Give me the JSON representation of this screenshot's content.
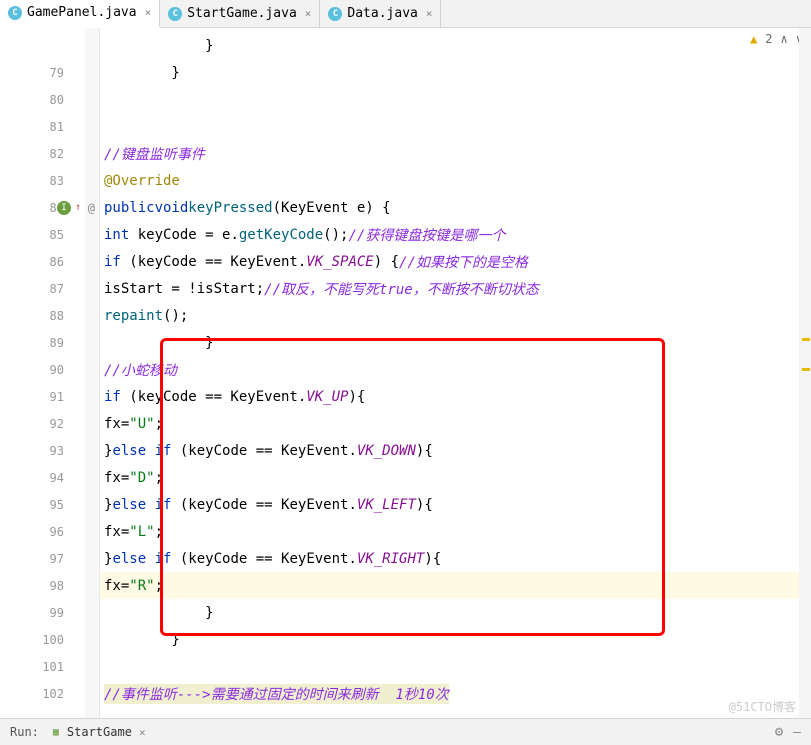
{
  "tabs": [
    {
      "label": "GamePanel.java",
      "active": true
    },
    {
      "label": "StartGame.java",
      "active": false
    },
    {
      "label": "Data.java",
      "active": false
    }
  ],
  "warnings": {
    "count": "2"
  },
  "gutter": {
    "lines": [
      "",
      "79",
      "80",
      "81",
      "82",
      "83",
      "84",
      "85",
      "86",
      "87",
      "88",
      "89",
      "90",
      "91",
      "92",
      "93",
      "94",
      "95",
      "96",
      "97",
      "98",
      "99",
      "100",
      "101",
      "102"
    ]
  },
  "code": {
    "l79": "        }",
    "l82_comment": "//键盘监听事件",
    "l83_anno": "@Override",
    "l84_kw1": "public",
    "l84_kw2": "void",
    "l84_method": "keyPressed",
    "l84_rest": "(KeyEvent e) {",
    "l85_kw": "int",
    "l85_rest": " keyCode = e.",
    "l85_call": "getKeyCode",
    "l85_paren": "();",
    "l85_comment": "//获得键盘按键是哪一个",
    "l86_kw": "if",
    "l86_rest": " (keyCode == KeyEvent.",
    "l86_const": "VK_SPACE",
    "l86_paren": ") {",
    "l86_comment": "//如果按下的是空格",
    "l87_text": "isStart = !isStart;",
    "l87_comment": "//取反，不能写死true，不断按不断切状态",
    "l88_call": "repaint",
    "l88_paren": "();",
    "l89": "            }",
    "l90_comment": "//小蛇移动",
    "l91_kw": "if",
    "l91_rest": " (keyCode == KeyEvent.",
    "l91_const": "VK_UP",
    "l91_paren": "){",
    "l92_a": "fx=",
    "l92_str": "\"U\"",
    "l92_b": ";",
    "l93_a": "}",
    "l93_kw": "else if",
    "l93_rest": " (keyCode == KeyEvent.",
    "l93_const": "VK_DOWN",
    "l93_paren": "){",
    "l94_a": "fx=",
    "l94_str": "\"D\"",
    "l94_b": ";",
    "l95_a": "}",
    "l95_kw": "else if",
    "l95_rest": " (keyCode == KeyEvent.",
    "l95_const": "VK_LEFT",
    "l95_paren": "){",
    "l96_a": "fx=",
    "l96_str": "\"L\"",
    "l96_b": ";",
    "l97_a": "}",
    "l97_kw": "else if",
    "l97_rest": " (keyCode == KeyEvent.",
    "l97_const": "VK_RIGHT",
    "l97_paren": "){",
    "l98_a": "fx=",
    "l98_str": "\"R\"",
    "l98_b": ";",
    "l99": "            }",
    "l100": "        }",
    "l102_comment": "//事件监听--->需要通过固定的时间来刷新  1秒10次"
  },
  "run": {
    "label": "Run:",
    "config": "StartGame"
  },
  "watermark": "@51CTO博客"
}
